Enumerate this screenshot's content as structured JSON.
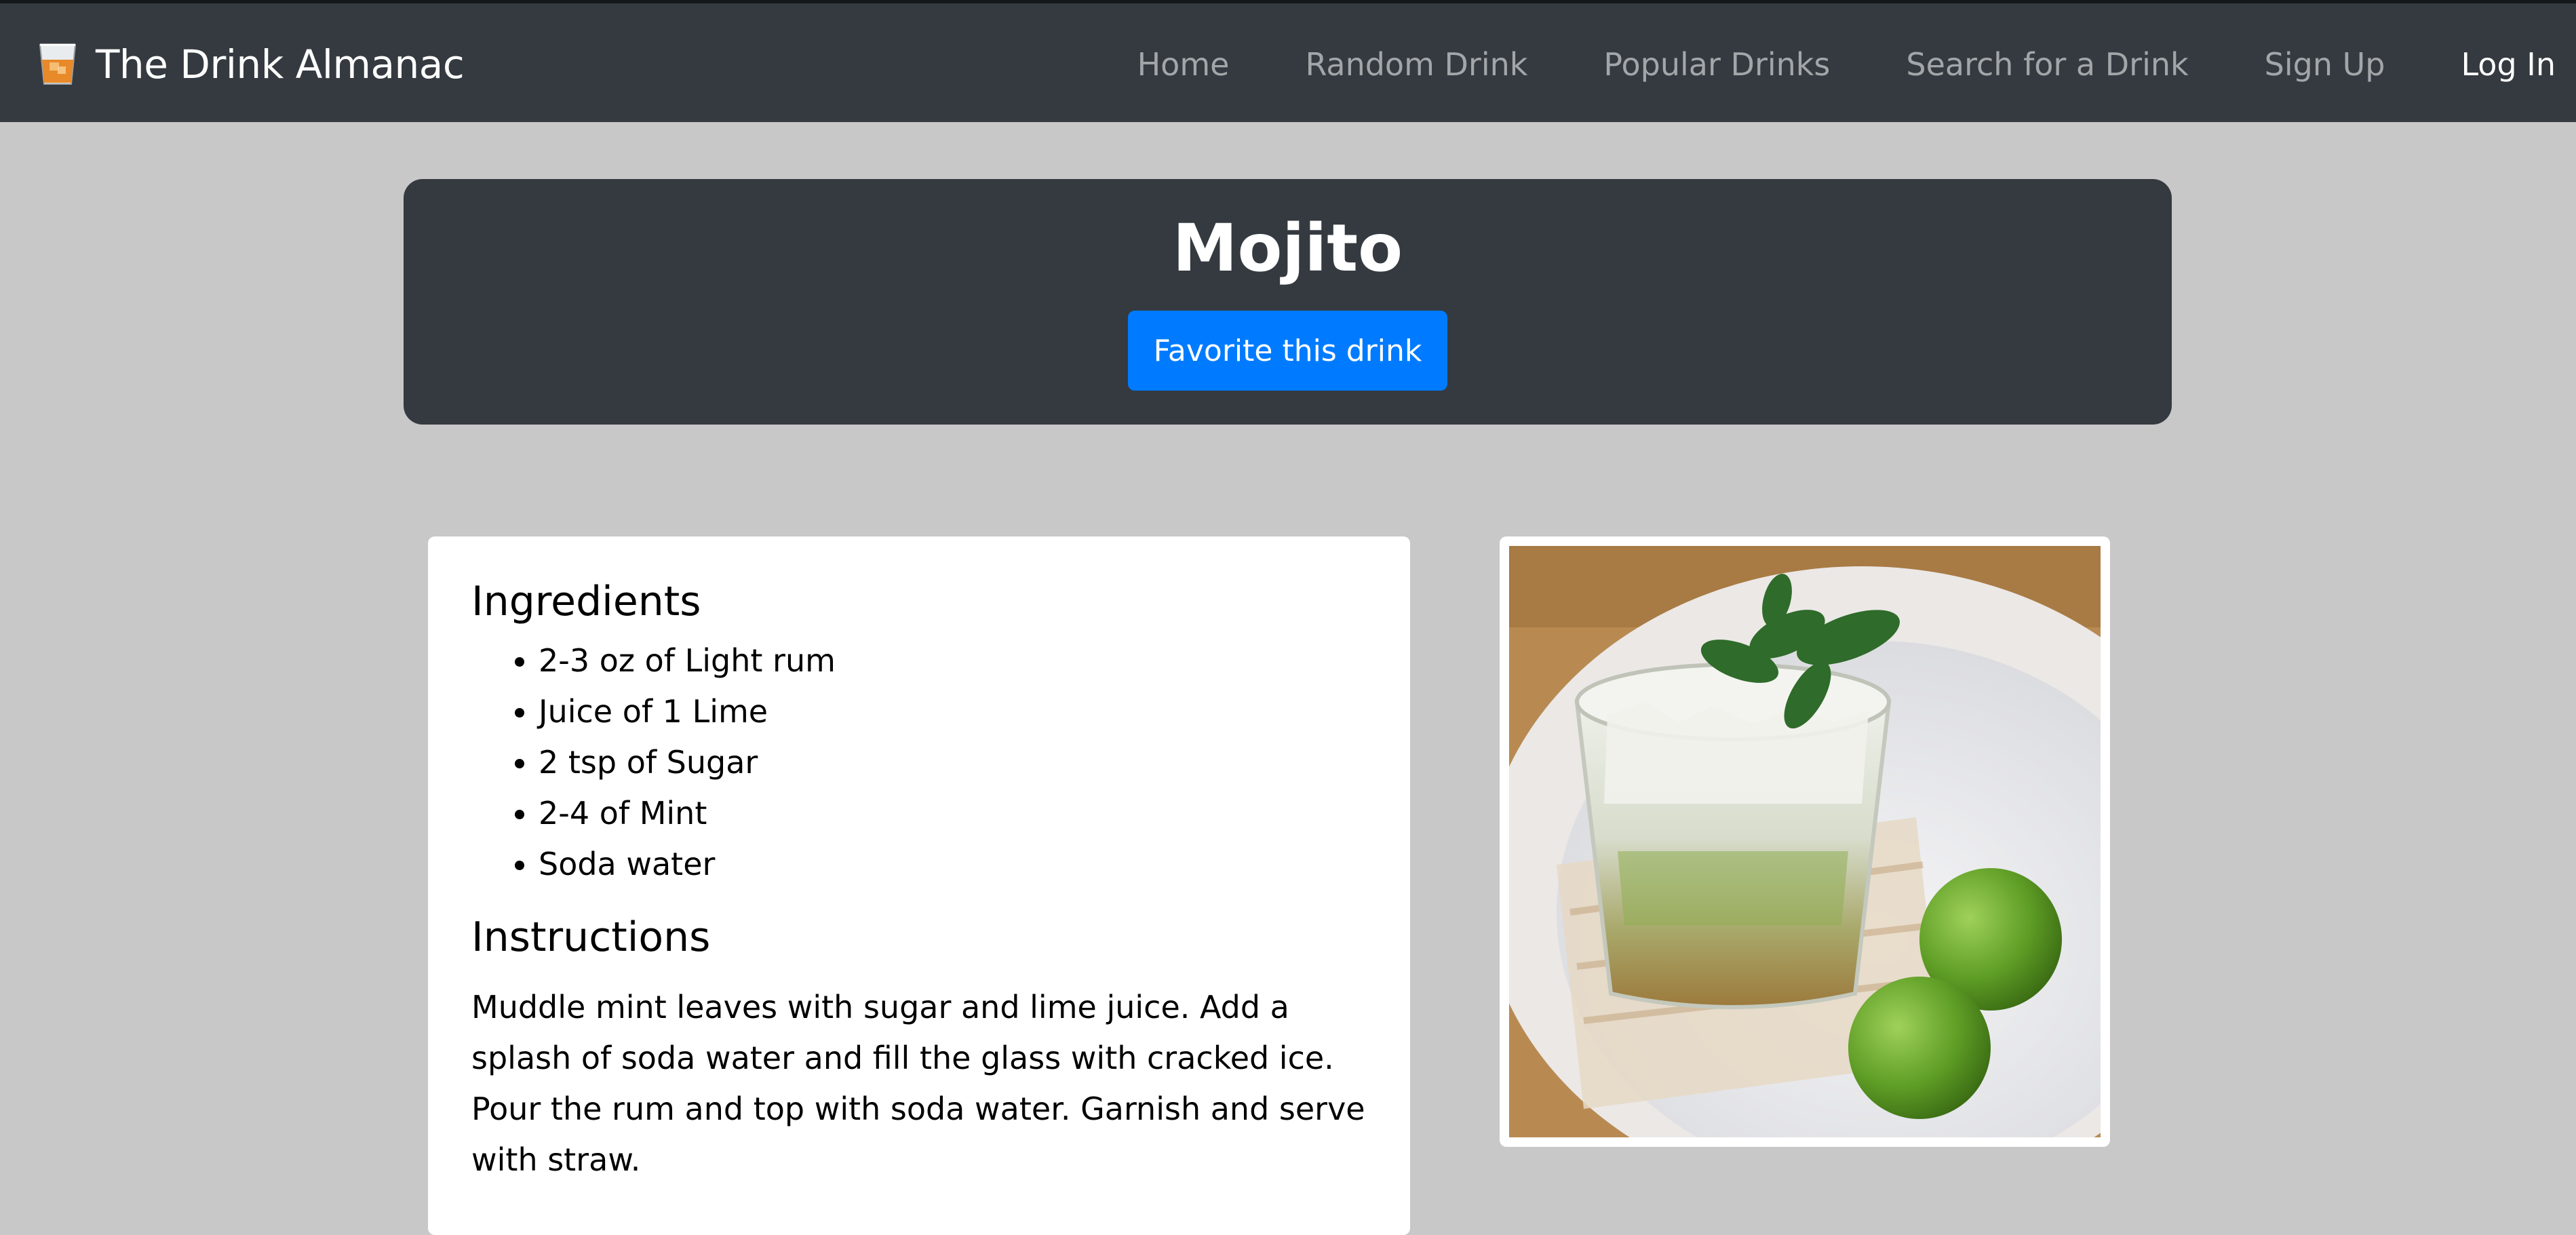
{
  "navbar": {
    "brand": "The Drink Almanac",
    "brand_icon": "whiskey-glass-icon",
    "links": [
      {
        "label": "Home",
        "active": false
      },
      {
        "label": "Random Drink",
        "active": false
      },
      {
        "label": "Popular Drinks",
        "active": false
      },
      {
        "label": "Search for a Drink",
        "active": false
      },
      {
        "label": "Sign Up",
        "active": false
      },
      {
        "label": "Log In",
        "active": true
      }
    ]
  },
  "drink": {
    "name": "Mojito",
    "favorite_label": "Favorite this drink",
    "ingredients_heading": "Ingredients",
    "ingredients": [
      "2-3 oz of Light rum",
      "Juice of 1 Lime",
      "2 tsp of Sugar",
      "2-4 of Mint",
      "Soda water"
    ],
    "instructions_heading": "Instructions",
    "instructions": "Muddle mint leaves with sugar and lime juice. Add a splash of soda water and fill the glass with cracked ice. Pour the rum and top with soda water. Garnish and serve with straw."
  },
  "colors": {
    "navbar_bg": "#343a40",
    "page_bg": "#c8c8c8",
    "primary_button": "#007bff"
  }
}
